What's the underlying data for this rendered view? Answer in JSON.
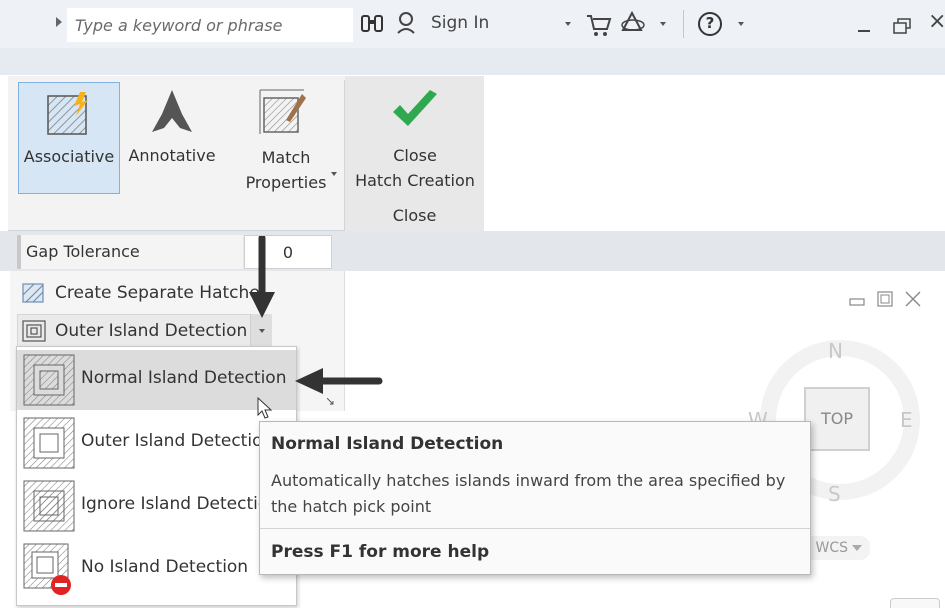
{
  "titlebar": {
    "search_placeholder": "Type a keyword or phrase",
    "sign_in": "Sign In",
    "help_symbol": "?"
  },
  "ribbon": {
    "associative": "Associative",
    "annotative": "Annotative",
    "match_line1": "Match",
    "match_line2": "Properties",
    "close_line1": "Close",
    "close_line2": "Hatch Creation",
    "close_panel_label": "Close"
  },
  "options": {
    "gap_tolerance_label": "Gap Tolerance",
    "gap_tolerance_value": "0",
    "create_separate": "Create Separate Hatche",
    "outer_island": "Outer Island Detection"
  },
  "island_list": {
    "items": [
      {
        "label": "Normal Island Detection",
        "icon": "normal-island-icon",
        "active": true
      },
      {
        "label": "Outer Island Detectio",
        "icon": "outer-island-icon",
        "active": false
      },
      {
        "label": "Ignore Island Detectio",
        "icon": "ignore-island-icon",
        "active": false
      },
      {
        "label": "No Island Detection",
        "icon": "no-island-icon",
        "active": false
      }
    ]
  },
  "tooltip": {
    "title": "Normal Island Detection",
    "description": "Automatically hatches islands inward from the area specified by the hatch pick point",
    "help": "Press F1 for more help"
  },
  "viewcube": {
    "north": "N",
    "east": "E",
    "south": "S",
    "west": "W",
    "top": "TOP",
    "wcs": "WCS"
  },
  "colors": {
    "accent_blue": "#d6e6f5",
    "check_green": "#2fa84f",
    "no_red": "#e02424"
  }
}
